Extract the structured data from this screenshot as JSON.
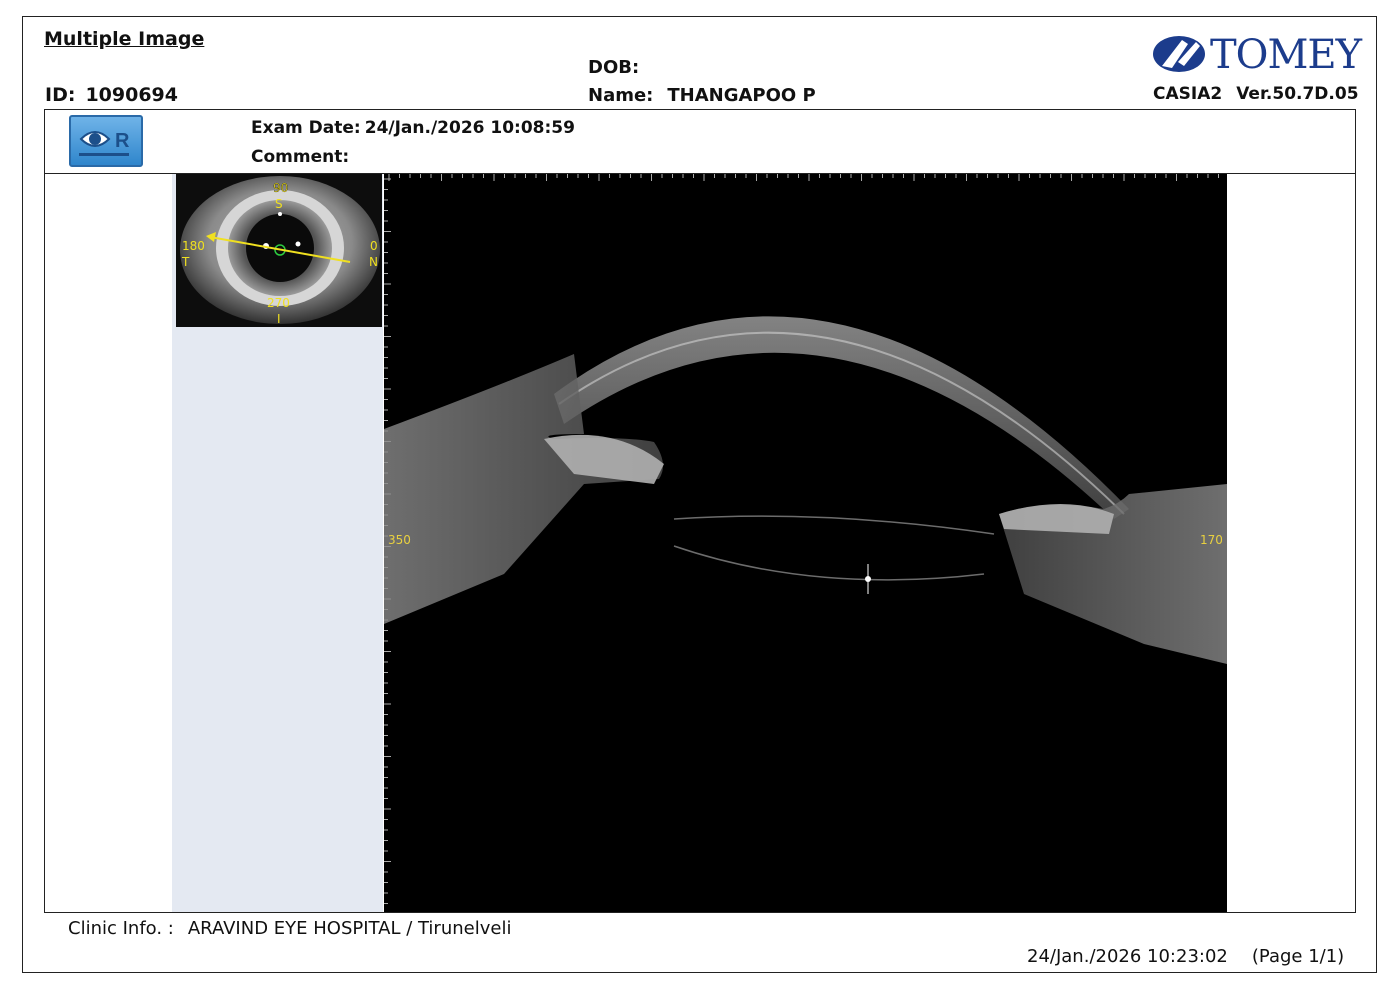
{
  "report": {
    "title": "Multiple Image",
    "id_label": "ID:",
    "id_value": "1090694",
    "dob_label": "DOB:",
    "name_label": "Name:",
    "name_value": "THANGAPOO P",
    "brand": "TOMEY",
    "model": "CASIA2",
    "version": "Ver.50.7D.05"
  },
  "exam": {
    "eye_button_label": "R",
    "date_label": "Exam Date:",
    "date_value": "24/Jan./2026 10:08:59",
    "comment_label": "Comment:"
  },
  "thumbnail": {
    "top_angle": "90",
    "top_letter": "S",
    "left_angle": "180",
    "left_letter": "T",
    "right_angle": "0",
    "right_letter": "N",
    "bottom_angle": "270",
    "bottom_letter": "I"
  },
  "scan": {
    "left_angle": "350",
    "right_angle": "170"
  },
  "footer": {
    "clinic_label": "Clinic Info. :",
    "clinic_value": "ARAVIND EYE HOSPITAL / Tirunelveli",
    "printed_date": "24/Jan./2026 10:23:02",
    "page": "(Page 1/1)"
  },
  "colors": {
    "brand_blue": "#1c3c8c",
    "button_blue": "#3a8fd6",
    "side_panel": "#e4e9f2",
    "overlay_yellow": "#f0e020"
  }
}
